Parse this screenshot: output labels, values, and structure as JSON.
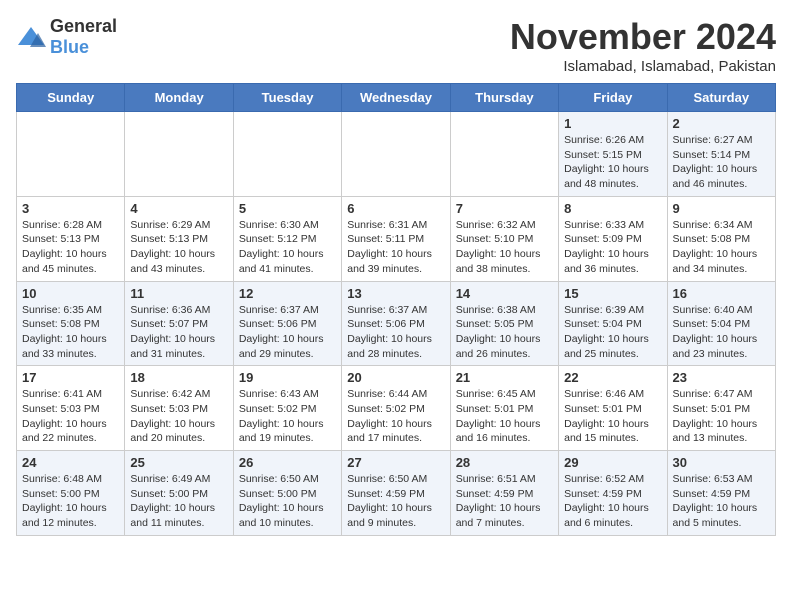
{
  "logo": {
    "general": "General",
    "blue": "Blue"
  },
  "title": "November 2024",
  "location": "Islamabad, Islamabad, Pakistan",
  "days_of_week": [
    "Sunday",
    "Monday",
    "Tuesday",
    "Wednesday",
    "Thursday",
    "Friday",
    "Saturday"
  ],
  "weeks": [
    [
      {
        "day": "",
        "info": ""
      },
      {
        "day": "",
        "info": ""
      },
      {
        "day": "",
        "info": ""
      },
      {
        "day": "",
        "info": ""
      },
      {
        "day": "",
        "info": ""
      },
      {
        "day": "1",
        "info": "Sunrise: 6:26 AM\nSunset: 5:15 PM\nDaylight: 10 hours and 48 minutes."
      },
      {
        "day": "2",
        "info": "Sunrise: 6:27 AM\nSunset: 5:14 PM\nDaylight: 10 hours and 46 minutes."
      }
    ],
    [
      {
        "day": "3",
        "info": "Sunrise: 6:28 AM\nSunset: 5:13 PM\nDaylight: 10 hours and 45 minutes."
      },
      {
        "day": "4",
        "info": "Sunrise: 6:29 AM\nSunset: 5:13 PM\nDaylight: 10 hours and 43 minutes."
      },
      {
        "day": "5",
        "info": "Sunrise: 6:30 AM\nSunset: 5:12 PM\nDaylight: 10 hours and 41 minutes."
      },
      {
        "day": "6",
        "info": "Sunrise: 6:31 AM\nSunset: 5:11 PM\nDaylight: 10 hours and 39 minutes."
      },
      {
        "day": "7",
        "info": "Sunrise: 6:32 AM\nSunset: 5:10 PM\nDaylight: 10 hours and 38 minutes."
      },
      {
        "day": "8",
        "info": "Sunrise: 6:33 AM\nSunset: 5:09 PM\nDaylight: 10 hours and 36 minutes."
      },
      {
        "day": "9",
        "info": "Sunrise: 6:34 AM\nSunset: 5:08 PM\nDaylight: 10 hours and 34 minutes."
      }
    ],
    [
      {
        "day": "10",
        "info": "Sunrise: 6:35 AM\nSunset: 5:08 PM\nDaylight: 10 hours and 33 minutes."
      },
      {
        "day": "11",
        "info": "Sunrise: 6:36 AM\nSunset: 5:07 PM\nDaylight: 10 hours and 31 minutes."
      },
      {
        "day": "12",
        "info": "Sunrise: 6:37 AM\nSunset: 5:06 PM\nDaylight: 10 hours and 29 minutes."
      },
      {
        "day": "13",
        "info": "Sunrise: 6:37 AM\nSunset: 5:06 PM\nDaylight: 10 hours and 28 minutes."
      },
      {
        "day": "14",
        "info": "Sunrise: 6:38 AM\nSunset: 5:05 PM\nDaylight: 10 hours and 26 minutes."
      },
      {
        "day": "15",
        "info": "Sunrise: 6:39 AM\nSunset: 5:04 PM\nDaylight: 10 hours and 25 minutes."
      },
      {
        "day": "16",
        "info": "Sunrise: 6:40 AM\nSunset: 5:04 PM\nDaylight: 10 hours and 23 minutes."
      }
    ],
    [
      {
        "day": "17",
        "info": "Sunrise: 6:41 AM\nSunset: 5:03 PM\nDaylight: 10 hours and 22 minutes."
      },
      {
        "day": "18",
        "info": "Sunrise: 6:42 AM\nSunset: 5:03 PM\nDaylight: 10 hours and 20 minutes."
      },
      {
        "day": "19",
        "info": "Sunrise: 6:43 AM\nSunset: 5:02 PM\nDaylight: 10 hours and 19 minutes."
      },
      {
        "day": "20",
        "info": "Sunrise: 6:44 AM\nSunset: 5:02 PM\nDaylight: 10 hours and 17 minutes."
      },
      {
        "day": "21",
        "info": "Sunrise: 6:45 AM\nSunset: 5:01 PM\nDaylight: 10 hours and 16 minutes."
      },
      {
        "day": "22",
        "info": "Sunrise: 6:46 AM\nSunset: 5:01 PM\nDaylight: 10 hours and 15 minutes."
      },
      {
        "day": "23",
        "info": "Sunrise: 6:47 AM\nSunset: 5:01 PM\nDaylight: 10 hours and 13 minutes."
      }
    ],
    [
      {
        "day": "24",
        "info": "Sunrise: 6:48 AM\nSunset: 5:00 PM\nDaylight: 10 hours and 12 minutes."
      },
      {
        "day": "25",
        "info": "Sunrise: 6:49 AM\nSunset: 5:00 PM\nDaylight: 10 hours and 11 minutes."
      },
      {
        "day": "26",
        "info": "Sunrise: 6:50 AM\nSunset: 5:00 PM\nDaylight: 10 hours and 10 minutes."
      },
      {
        "day": "27",
        "info": "Sunrise: 6:50 AM\nSunset: 4:59 PM\nDaylight: 10 hours and 9 minutes."
      },
      {
        "day": "28",
        "info": "Sunrise: 6:51 AM\nSunset: 4:59 PM\nDaylight: 10 hours and 7 minutes."
      },
      {
        "day": "29",
        "info": "Sunrise: 6:52 AM\nSunset: 4:59 PM\nDaylight: 10 hours and 6 minutes."
      },
      {
        "day": "30",
        "info": "Sunrise: 6:53 AM\nSunset: 4:59 PM\nDaylight: 10 hours and 5 minutes."
      }
    ]
  ]
}
